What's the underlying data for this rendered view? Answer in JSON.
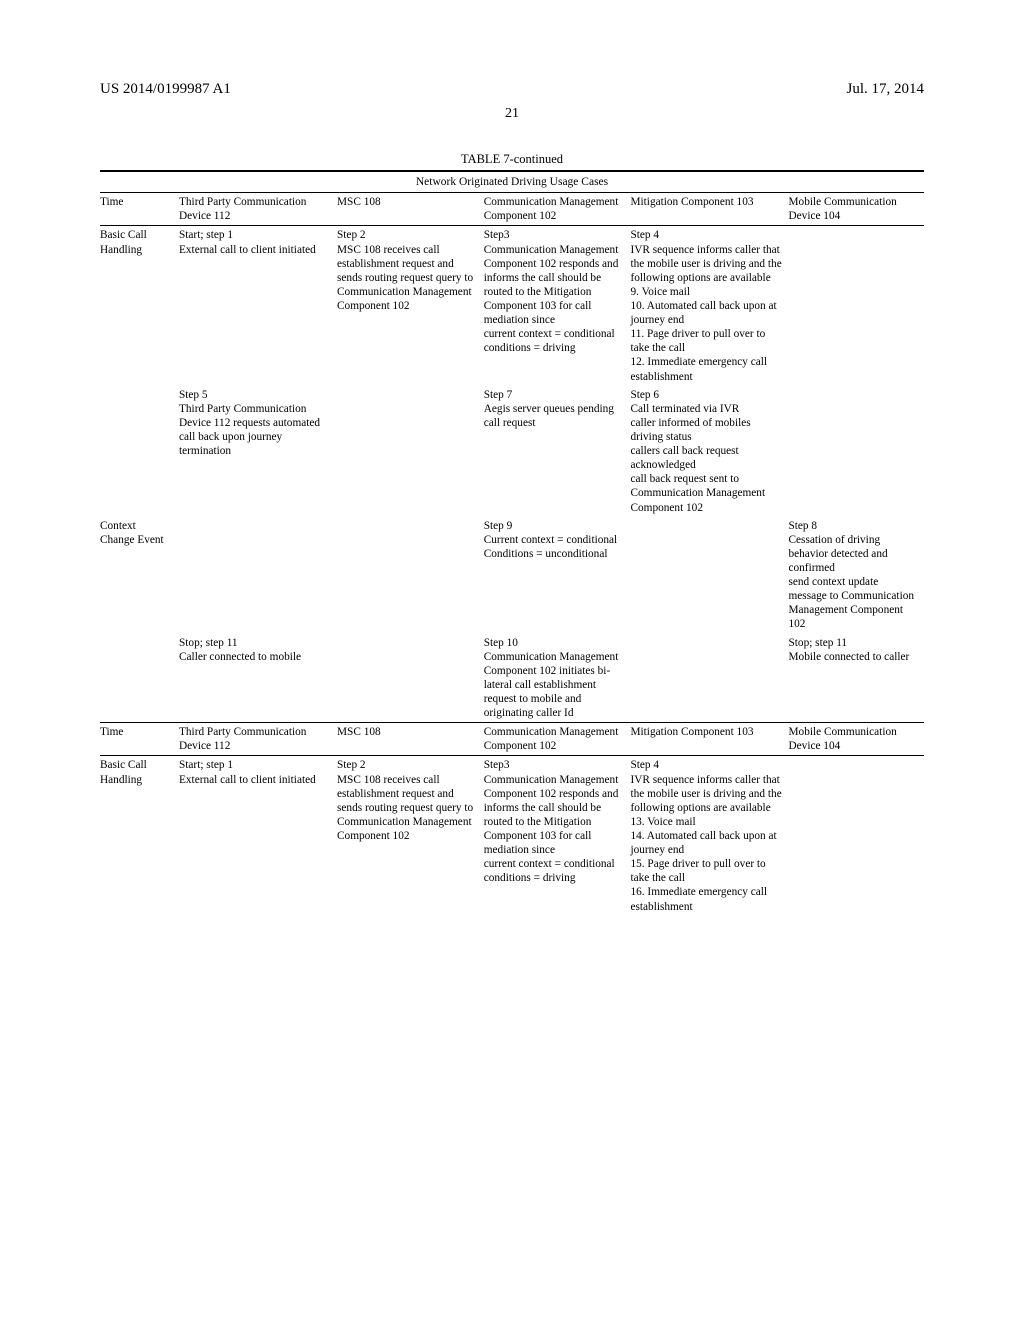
{
  "header": {
    "left": "US 2014/0199987 A1",
    "right": "Jul. 17, 2014"
  },
  "page_number": "21",
  "tbl_title": "TABLE 7-continued",
  "tbl_subtitle": "Network Originated Driving Usage Cases",
  "columns": {
    "c0": "Time",
    "c1": "Third Party Communication Device 112",
    "c2": "MSC 108",
    "c3": "Communication Management Component 102",
    "c4": "Mitigation Component 103",
    "c5": "Mobile Communication Device 104"
  },
  "rows1": [
    {
      "c0": "Basic Call Handling",
      "c1": "Start; step 1\nExternal call to client initiated",
      "c2": "Step 2\nMSC 108 receives call establishment request and sends routing request query to Communication Management Component 102",
      "c3": "Step3\nCommunication Management Component 102 responds and informs the call should be routed to the Mitigation Component 103 for call mediation since\ncurrent context = conditional\nconditions = driving",
      "c4": "Step 4\nIVR sequence informs caller that the mobile user is driving and the following options are available\n9. Voice mail\n10. Automated call back upon at journey end\n11. Page driver to pull over to take the call\n12. Immediate emergency call establishment",
      "c5": ""
    },
    {
      "c0": "",
      "c1": "Step 5\nThird Party Communication Device 112 requests automated call back upon journey termination",
      "c2": "",
      "c3": "Step 7\nAegis server queues pending call request",
      "c4": "Step 6\nCall terminated via IVR\ncaller informed of mobiles driving status\ncallers call back request acknowledged\ncall back request sent to Communication Management Component 102",
      "c5": ""
    },
    {
      "c0": "Context Change Event",
      "c1": "",
      "c2": "",
      "c3": "Step 9\nCurrent context = conditional\nConditions = unconditional",
      "c4": "",
      "c5": "Step 8\nCessation of driving behavior detected and confirmed\nsend context update message to Communication Management Component 102"
    },
    {
      "c0": "",
      "c1": "Stop; step 11\nCaller connected to mobile",
      "c2": "",
      "c3": "Step 10\nCommunication Management Component 102 initiates bi-lateral call establishment request to mobile and originating caller Id",
      "c4": "",
      "c5": "Stop; step 11\nMobile connected to caller"
    }
  ],
  "rows2": [
    {
      "c0": "Basic Call Handling",
      "c1": "Start; step 1\nExternal call to client initiated",
      "c2": "Step 2\nMSC 108 receives call establishment request and sends routing request query to Communication Management Component 102",
      "c3": "Step3\nCommunication Management Component 102 responds and informs the call should be routed to the Mitigation Component 103 for call mediation since\ncurrent context = conditional\nconditions = driving",
      "c4": "Step 4\nIVR sequence informs caller that the mobile user is driving and the following options are available\n13. Voice mail\n14. Automated call back upon at journey end\n15. Page driver to pull over to take the call\n16. Immediate emergency call establishment",
      "c5": ""
    }
  ]
}
